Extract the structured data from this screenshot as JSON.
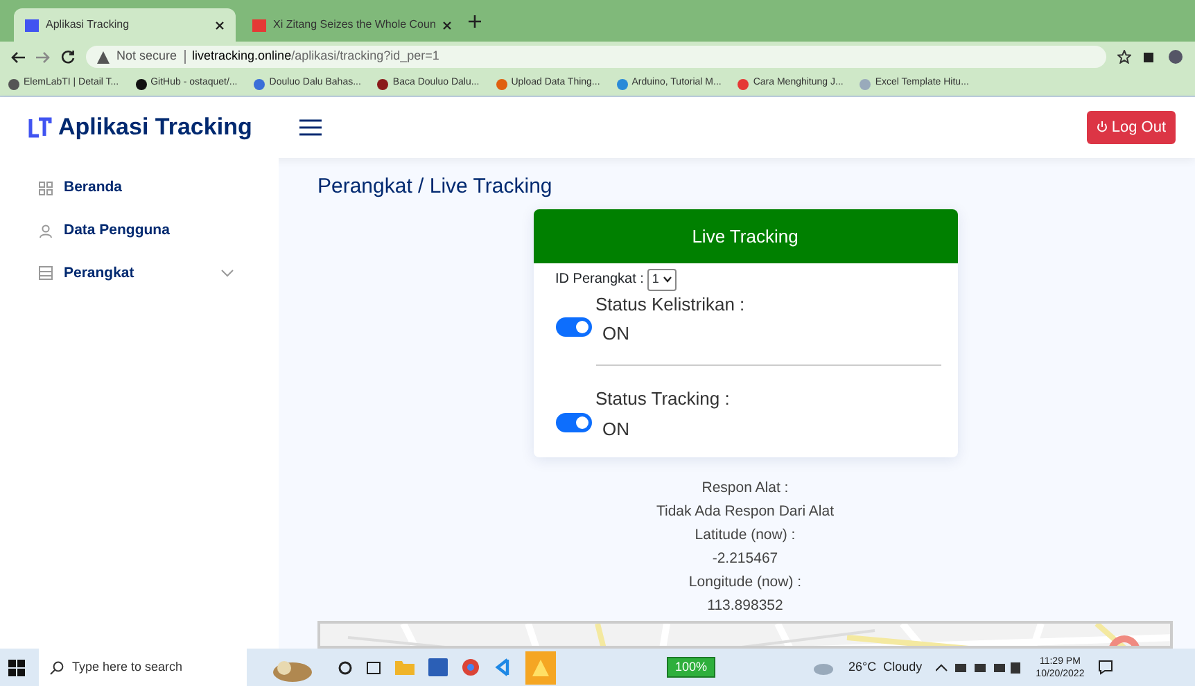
{
  "browser": {
    "tabs": [
      {
        "title": "Aplikasi Tracking",
        "selected": true
      },
      {
        "title": "Xi Zitang Seizes the Whole Coun",
        "selected": false
      }
    ],
    "address": {
      "security": "Not secure",
      "host": "livetracking.online",
      "path": "/aplikasi/tracking?id_per=1"
    },
    "bookmarks": [
      "ElemLabTI | Detail T...",
      "GitHub - ostaquet/...",
      "Douluo Dalu Bahas...",
      "Baca Douluo Dalu...",
      "Upload Data Thing...",
      "Arduino, Tutorial M...",
      "Cara Menghitung J...",
      "Excel Template Hitu..."
    ]
  },
  "app": {
    "brand": "Aplikasi Tracking",
    "logout": "Log Out",
    "sidebar": {
      "items": [
        {
          "label": "Beranda",
          "kind": "link"
        },
        {
          "label": "Data Pengguna",
          "kind": "link"
        },
        {
          "label": "Perangkat",
          "kind": "dropdown"
        }
      ]
    },
    "breadcrumb": "Perangkat / Live Tracking",
    "card": {
      "title": "Live Tracking",
      "device_label": "ID Perangkat :",
      "device_value": "1",
      "statuses": [
        {
          "label": "Status Kelistrikan :",
          "on": true,
          "state_text": "ON"
        },
        {
          "label": "Status Tracking :",
          "on": true,
          "state_text": "ON"
        }
      ]
    },
    "info": [
      "Respon Alat :",
      "Tidak Ada Respon Dari Alat",
      "Latitude (now) :",
      "-2.215467",
      "Longitude (now) :",
      "113.898352"
    ]
  },
  "taskbar": {
    "search_placeholder": "Type here to search",
    "battery": "100%",
    "weather": "26°C  Cloudy",
    "time": "11:29 PM",
    "date": "10/20/2022"
  }
}
